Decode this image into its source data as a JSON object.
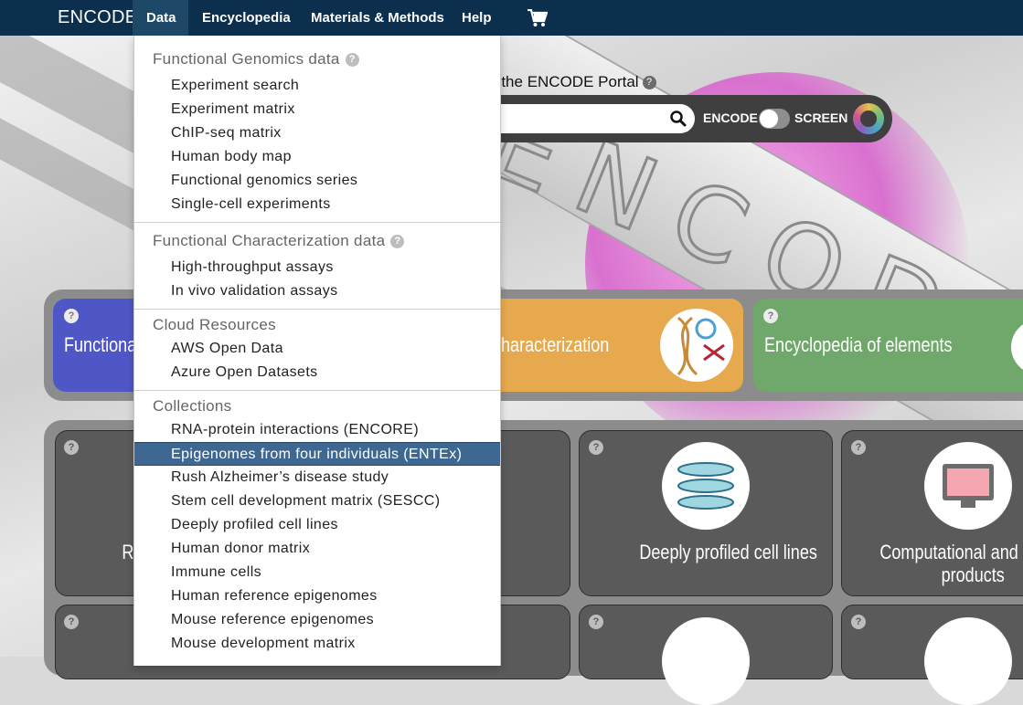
{
  "navbar": {
    "brand": "ENCODE",
    "items": [
      "Data",
      "Encyclopedia",
      "Materials & Methods",
      "Help"
    ],
    "cart_icon": "shopping-cart-icon"
  },
  "search": {
    "label": "rch the ENCODE Portal",
    "placeholder": "",
    "toggle_left": "ENCODE",
    "toggle_right": "SCREEN"
  },
  "categories": [
    {
      "title": "Functional"
    },
    {
      "title": "haracterization"
    },
    {
      "title": "Encyclopedia of elements"
    }
  ],
  "tiles": {
    "tile1_partial": "R",
    "tile2": "Deeply profiled cell lines",
    "tile3_line1": "Computational and inte",
    "tile3_line2": "products"
  },
  "dropdown": {
    "sections": [
      {
        "heading": "Functional Genomics data",
        "items": [
          "Experiment search",
          "Experiment matrix",
          "ChIP-seq matrix",
          "Human body map",
          "Functional genomics series",
          "Single-cell experiments"
        ]
      },
      {
        "heading": "Functional Characterization data",
        "items": [
          "High-throughput assays",
          "In vivo validation assays"
        ]
      },
      {
        "heading": "Cloud Resources",
        "items": [
          "AWS Open Data",
          "Azure Open Datasets"
        ]
      },
      {
        "heading": "Collections",
        "items": [
          "RNA-protein interactions (ENCORE)",
          "Epigenomes from four individuals (ENTEx)",
          "Rush Alzheimer’s disease study",
          "Stem cell development matrix (SESCC)",
          "Deeply profiled cell lines",
          "Human donor matrix",
          "Immune cells",
          "Human reference epigenomes",
          "Mouse reference epigenomes",
          "Mouse development matrix"
        ]
      }
    ],
    "active_item": "Epigenomes from four individuals (ENTEx)"
  },
  "colors": {
    "navbar": "#0b2f4d",
    "active": "#3e6891",
    "fg_card": "#4f57c6",
    "fc_card": "#e7a94e",
    "enc_card": "#6fa86a"
  }
}
